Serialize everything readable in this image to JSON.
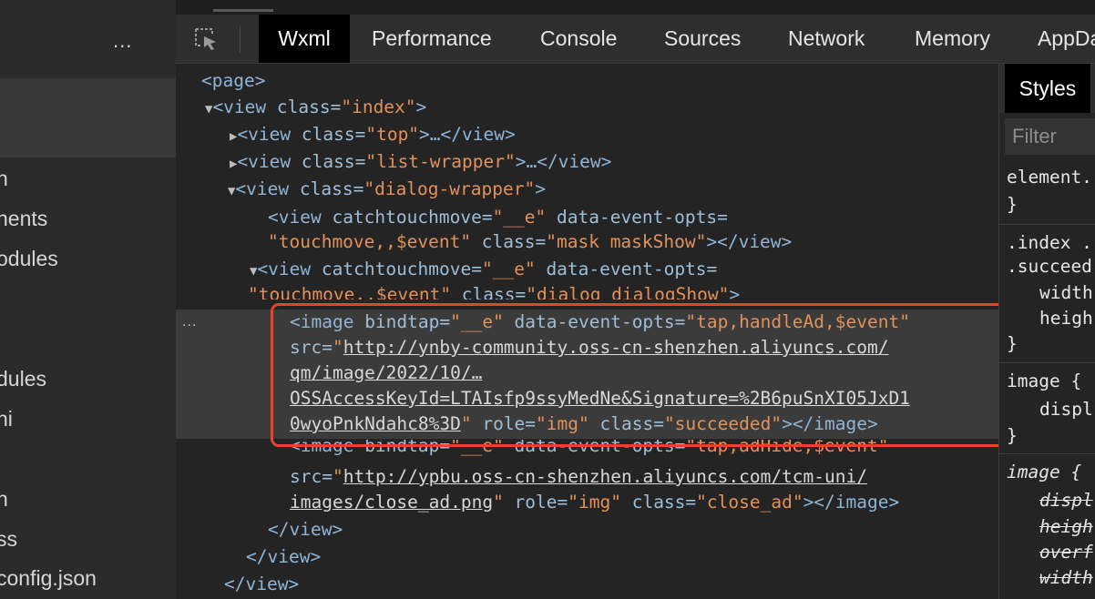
{
  "sidebar": {
    "more_label": "...",
    "items": [
      "n",
      "nents",
      "odules",
      "dules",
      "ni",
      "n",
      "ss",
      "config.json"
    ]
  },
  "devtools": {
    "tabs": [
      "Wxml",
      "Performance",
      "Console",
      "Sources",
      "Network",
      "Memory",
      "AppDa"
    ],
    "active_tab": "Wxml"
  },
  "wxml": {
    "page_open": "<page>",
    "index_open": [
      "<view ",
      "class=",
      "\"index\"",
      ">"
    ],
    "top": [
      "<view ",
      "class=",
      "\"top\"",
      ">…</view>"
    ],
    "list_wrapper": [
      "<view ",
      "class=",
      "\"list-wrapper\"",
      ">…</view>"
    ],
    "dialog_wrapper": [
      "<view ",
      "class=",
      "\"dialog-wrapper\"",
      ">"
    ],
    "mask_l1": [
      "<view ",
      "catchtouchmove=",
      "\"__e\"",
      " data-event-opts="
    ],
    "mask_l2": [
      "\"touchmove,,$event\"",
      " class=",
      "\"mask maskShow\"",
      "></view>"
    ],
    "dialog_l1": [
      "<view ",
      "catchtouchmove=",
      "\"__e\"",
      " data-event-opts="
    ],
    "dialog_l2": [
      "\"touchmove,,$event\"",
      " class=",
      "\"dialog dialogShow\"",
      ">"
    ],
    "img1_l1": [
      "<image ",
      "bindtap=",
      "\"__e\"",
      " data-event-opts=",
      "\"tap,handleAd,$event\""
    ],
    "img1_l2": [
      "src=",
      "\"",
      "http://ynby-community.oss-cn-shenzhen.aliyuncs.com/"
    ],
    "img1_l3": "qm/image/2022/10/…",
    "img1_l4": "OSSAccessKeyId=LTAIsfp9ssyMedNe&Signature=%2B6puSnXI05JxD1",
    "img1_l5": [
      "0wyoPnkNdahc8%3D",
      "\"",
      " role=",
      "\"img\"",
      " class=",
      "\"succeeded\"",
      "></image>"
    ],
    "img2_l1": [
      "<image ",
      "bindtap=",
      "\"__e\"",
      " data-event-opts=",
      "\"tap,adHide,$event\""
    ],
    "img2_l2": [
      "src=",
      "\"",
      "http://ypbu.oss-cn-shenzhen.aliyuncs.com/tcm-uni/"
    ],
    "img2_l3": [
      "images/close_ad.png",
      "\"",
      " role=",
      "\"img\"",
      " class=",
      "\"close_ad\"",
      "></image>"
    ],
    "close_view": "</view>",
    "dots": "..."
  },
  "styles_panel": {
    "tab": "Styles",
    "filter_placeholder": "Filter",
    "lines": [
      "element.",
      "}",
      ".index .",
      ".succeed",
      "width",
      "heigh",
      "}",
      "image {",
      "displ",
      "}",
      "image {",
      "displ",
      "heigh",
      "overf",
      "width"
    ]
  },
  "colors": {
    "highlight_box": "#e8422c",
    "tag": "#8fb4d6",
    "value": "#e3915a"
  }
}
